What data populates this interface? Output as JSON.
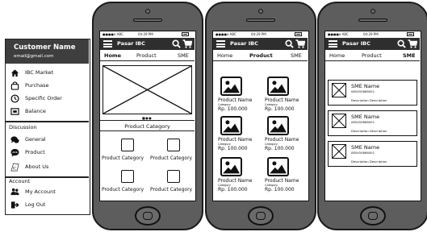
{
  "drawer": {
    "name": "Customer Name",
    "email": "email@gmail.com",
    "items": [
      {
        "label": "IBC Market",
        "icon": "home-icon"
      },
      {
        "label": "Purchase",
        "icon": "shopping-bag-icon"
      },
      {
        "label": "Specific Order",
        "icon": "clock-icon"
      },
      {
        "label": "Balance",
        "icon": "wallet-icon"
      }
    ],
    "discussion_title": "Discussion",
    "discussion_items": [
      {
        "label": "General",
        "icon": "chat-icon"
      },
      {
        "label": "Product",
        "icon": "message-dots-icon"
      },
      {
        "label": "About Us",
        "icon": "ibc-logo-icon"
      }
    ],
    "account_title": "Account",
    "account_items": [
      {
        "label": "My Account",
        "icon": "users-icon"
      },
      {
        "label": "Log Out",
        "icon": "logout-icon"
      }
    ]
  },
  "status": {
    "carrier": "●●●●o ABC",
    "time": "04:29 PM"
  },
  "app": {
    "title": "Pasar IBC"
  },
  "tabs": [
    "Home",
    "Product",
    "SME"
  ],
  "home": {
    "dots": "■●●",
    "product_category_title": "Product Category",
    "category_label": "Product Category"
  },
  "product": {
    "name": "Product Name",
    "category": "Category",
    "price": "Rp. 100.000"
  },
  "sme": {
    "name": "SME Name",
    "phone": "085450666001",
    "description": "Description Description"
  }
}
